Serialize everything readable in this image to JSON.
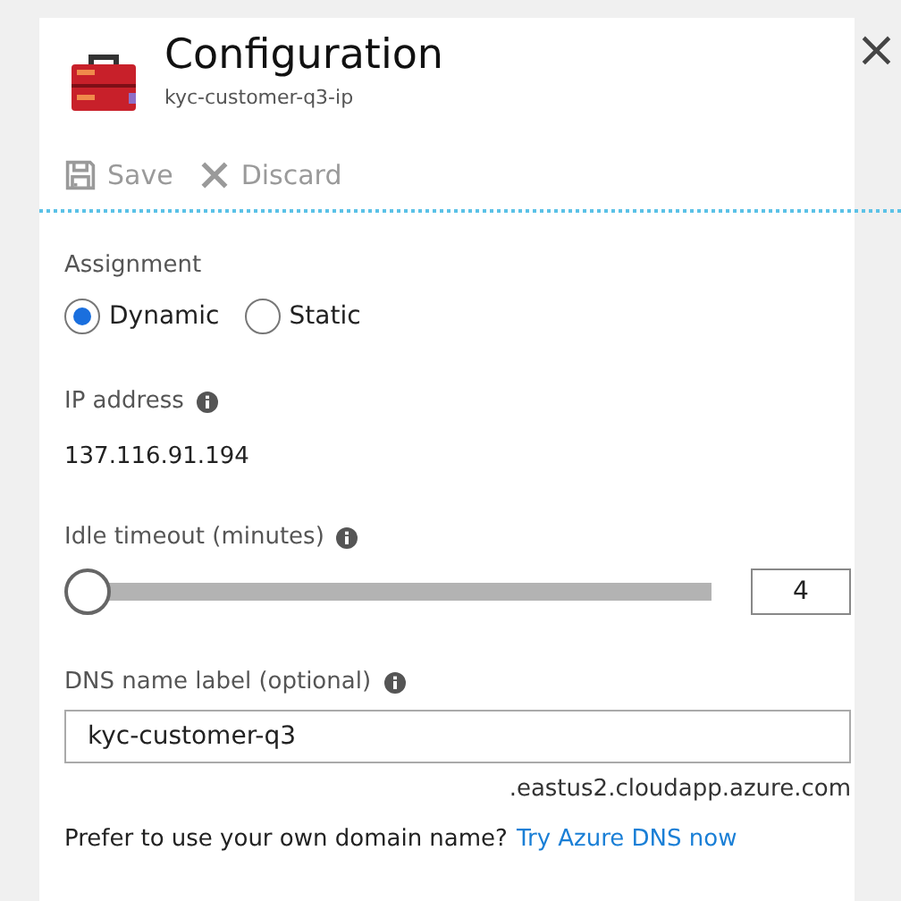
{
  "header": {
    "title": "Configuration",
    "subtitle": "kyc-customer-q3-ip",
    "close": "×"
  },
  "toolbar": [
    {
      "label": "Save",
      "kind": "save",
      "disabled": true
    },
    {
      "label": "Discard",
      "kind": "discard",
      "disabled": true
    }
  ],
  "assignment": {
    "label": "Assignment",
    "options": [
      {
        "label": "Dynamic",
        "selected": true
      },
      {
        "label": "Static",
        "selected": false
      }
    ]
  },
  "ip_address": {
    "label": "IP address",
    "value": "137.116.91.194"
  },
  "idle_timeout": {
    "label": "Idle timeout (minutes)",
    "level": 0,
    "value": "4"
  },
  "dns": {
    "label": "DNS name label (optional)",
    "value": "kyc-customer-q3",
    "suffix": ".eastus2.cloudapp.azure.com",
    "prompt": "Prefer to use your own domain name?",
    "link": "Try Azure DNS now"
  }
}
